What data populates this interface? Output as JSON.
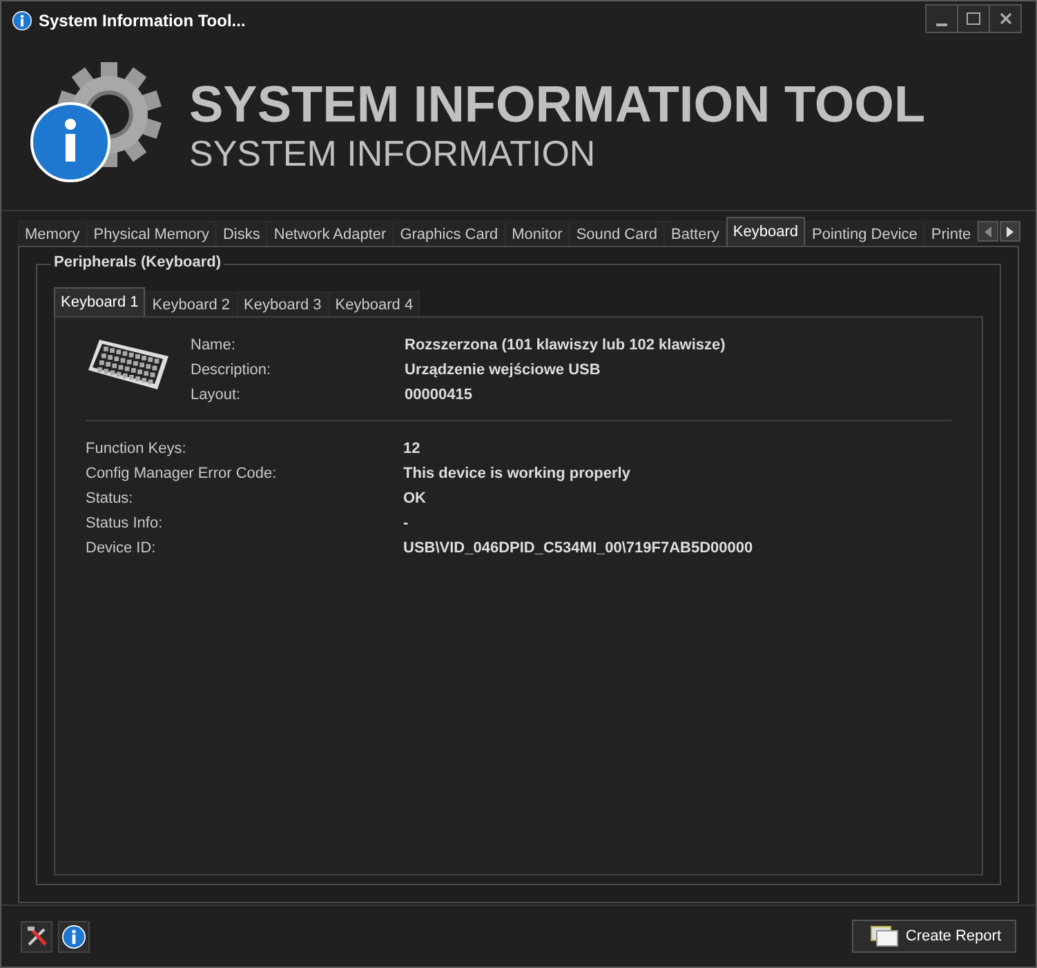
{
  "window": {
    "title": "System Information Tool..."
  },
  "header": {
    "title": "SYSTEM INFORMATION TOOL",
    "subtitle": "SYSTEM INFORMATION"
  },
  "tabs": [
    {
      "label": "Memory",
      "selected": false
    },
    {
      "label": "Physical Memory",
      "selected": false
    },
    {
      "label": "Disks",
      "selected": false
    },
    {
      "label": "Network Adapter",
      "selected": false
    },
    {
      "label": "Graphics Card",
      "selected": false
    },
    {
      "label": "Monitor",
      "selected": false
    },
    {
      "label": "Sound Card",
      "selected": false
    },
    {
      "label": "Battery",
      "selected": false
    },
    {
      "label": "Keyboard",
      "selected": true
    },
    {
      "label": "Pointing Device",
      "selected": false
    },
    {
      "label": "Printe",
      "selected": false
    }
  ],
  "group": {
    "title": "Peripherals (Keyboard)",
    "subtabs": [
      {
        "label": "Keyboard 1",
        "selected": true
      },
      {
        "label": "Keyboard 2",
        "selected": false
      },
      {
        "label": "Keyboard 3",
        "selected": false
      },
      {
        "label": "Keyboard 4",
        "selected": false
      }
    ],
    "summary": [
      {
        "label": "Name:",
        "value": "Rozszerzona (101 klawiszy lub 102 klawisze)"
      },
      {
        "label": "Description:",
        "value": "Urządzenie wejściowe USB"
      },
      {
        "label": "Layout:",
        "value": "00000415"
      }
    ],
    "details": [
      {
        "label": "Function Keys:",
        "value": "12"
      },
      {
        "label": "Config Manager Error Code:",
        "value": "This device is working properly"
      },
      {
        "label": "Status:",
        "value": "OK"
      },
      {
        "label": "Status Info:",
        "value": "-"
      },
      {
        "label": "Device ID:",
        "value": "USB\\VID_046DPID_C534MI_00\\719F7AB5D00000"
      }
    ]
  },
  "footer": {
    "report_button": "Create Report"
  }
}
